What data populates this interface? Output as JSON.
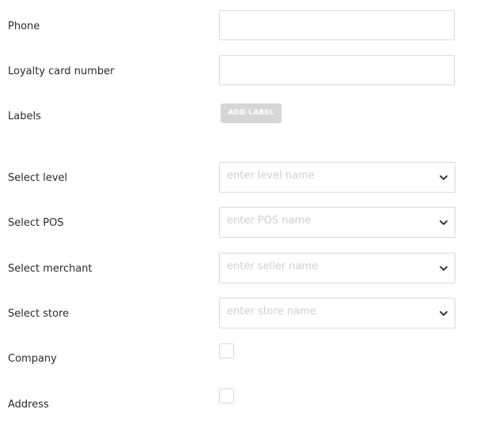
{
  "fields": {
    "phone": {
      "label": "Phone",
      "value": ""
    },
    "loyalty_card": {
      "label": "Loyalty card number",
      "value": ""
    },
    "labels": {
      "label": "Labels",
      "button": "ADD LABEL"
    },
    "level": {
      "label": "Select level",
      "placeholder": "enter level name"
    },
    "pos": {
      "label": "Select POS",
      "placeholder": "enter POS name"
    },
    "merchant": {
      "label": "Select merchant",
      "placeholder": "enter seller name"
    },
    "store": {
      "label": "Select store",
      "placeholder": "enter store name"
    },
    "company": {
      "label": "Company",
      "checked": false
    },
    "address": {
      "label": "Address",
      "checked": false
    }
  },
  "icons": {
    "dropdown": "chevron-down-icon"
  },
  "colors": {
    "border": "#d9d9d9",
    "button_bg": "#d6d6d6",
    "placeholder": "#cfcfcf",
    "label": "#2b2b2b"
  }
}
